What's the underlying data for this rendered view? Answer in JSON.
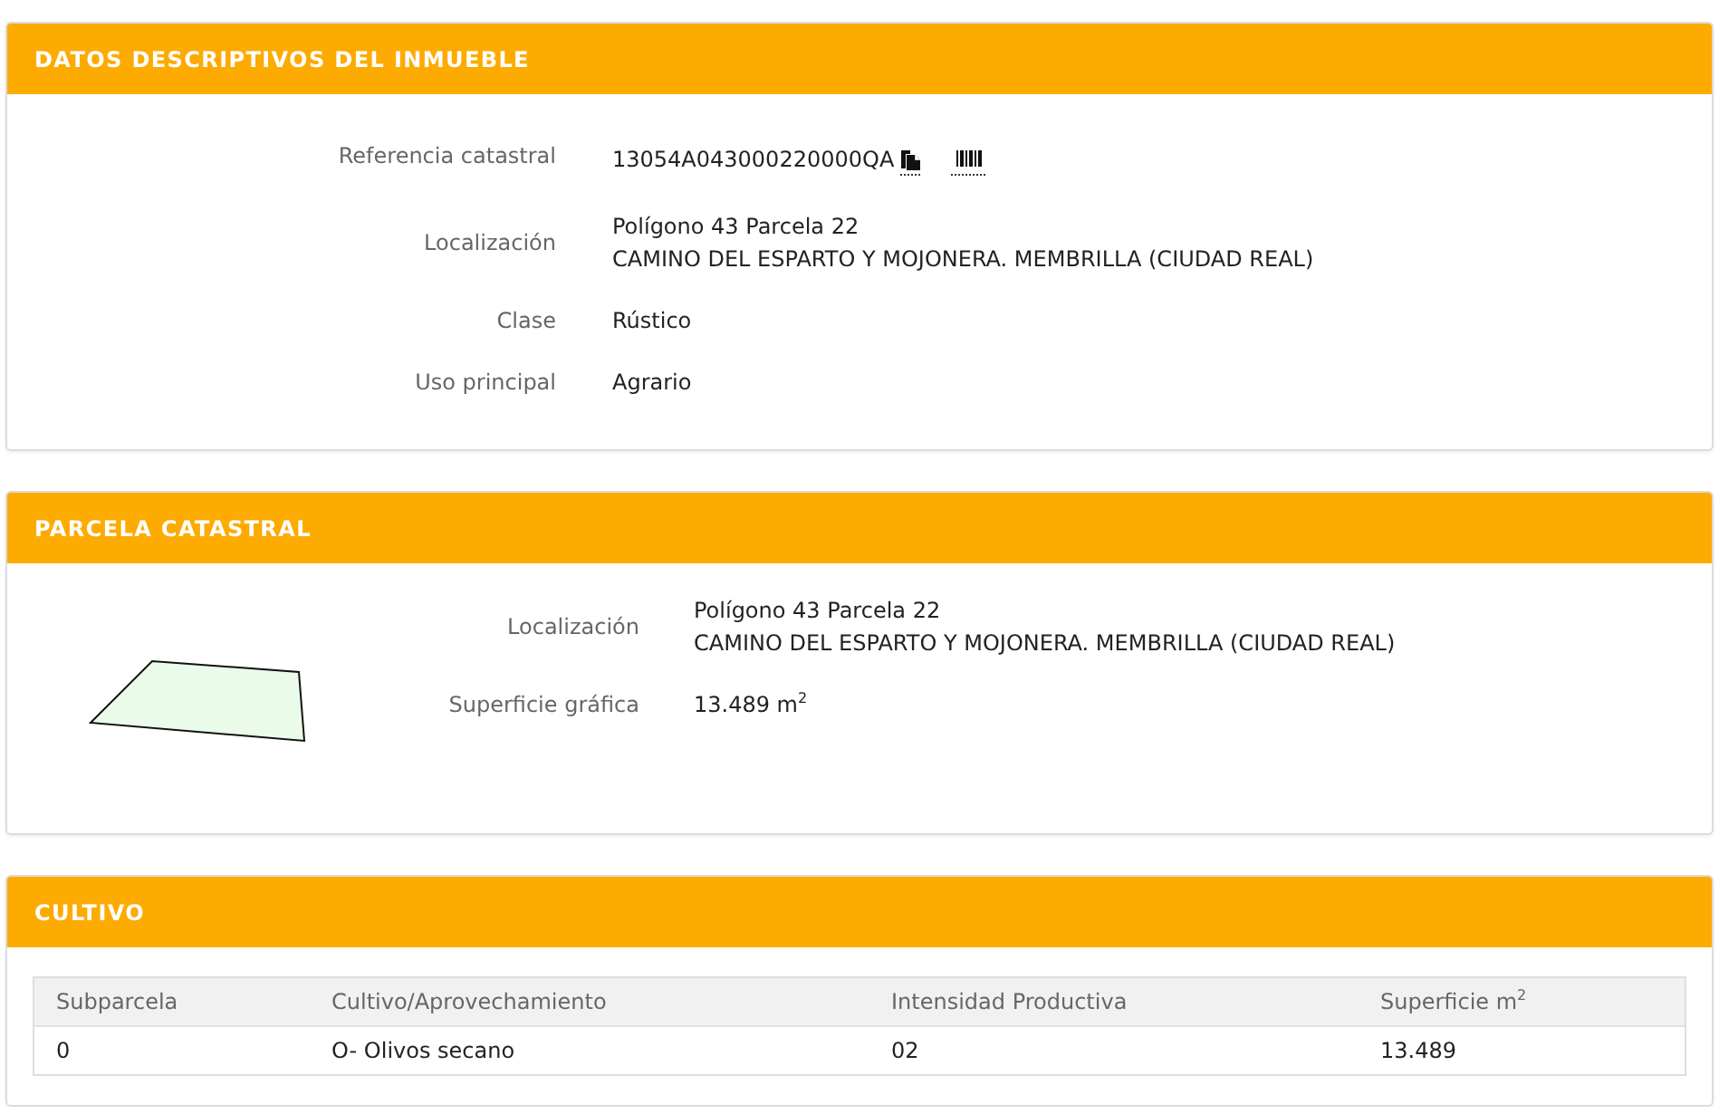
{
  "property_details": {
    "title": "DATOS DESCRIPTIVOS DEL INMUEBLE",
    "fields": [
      {
        "kind": "reference",
        "label": "Referencia catastral",
        "lines": [
          "13054A043000220000QA"
        ]
      },
      {
        "kind": "text",
        "label": "Localización",
        "lines": [
          "Polígono 43 Parcela 22",
          "CAMINO DEL ESPARTO Y MOJONERA. MEMBRILLA (CIUDAD REAL)"
        ]
      },
      {
        "kind": "text",
        "label": "Clase",
        "lines": [
          "Rústico"
        ]
      },
      {
        "kind": "text",
        "label": "Uso principal",
        "lines": [
          "Agrario"
        ]
      }
    ]
  },
  "parcel": {
    "title": "PARCELA CATASTRAL",
    "fields": [
      {
        "kind": "text",
        "label": "Localización",
        "lines": [
          "Polígono 43 Parcela 22",
          "CAMINO DEL ESPARTO Y MOJONERA. MEMBRILLA (CIUDAD REAL)"
        ]
      },
      {
        "kind": "text",
        "label": "Superficie gráfica",
        "lines": [
          "13.489 m$^{2}$"
        ]
      }
    ]
  },
  "crop": {
    "title": "CULTIVO",
    "table": {
      "columns": [
        "Subparcela",
        "Cultivo/Aprovechamiento",
        "Intensidad Productiva",
        "Superficie m$^{2}$"
      ],
      "rows": [
        [
          "0",
          "O- Olivos secano",
          "02",
          "13.489"
        ]
      ]
    }
  }
}
